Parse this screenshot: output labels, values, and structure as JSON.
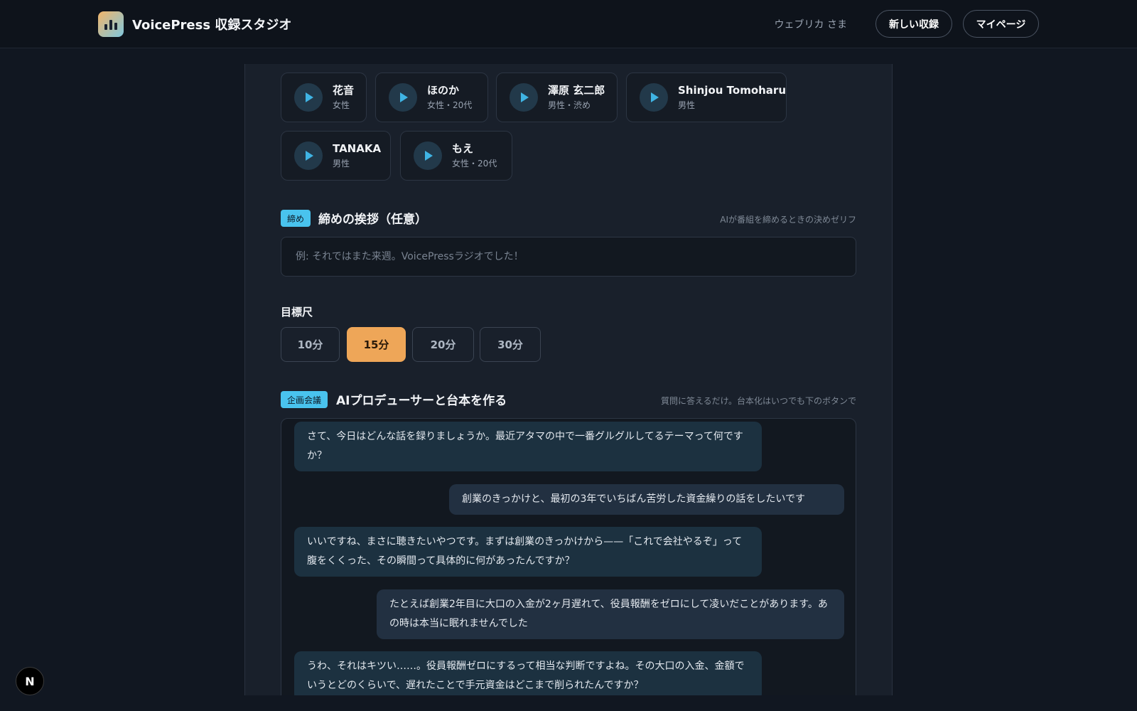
{
  "header": {
    "title": "VoicePress 収録スタジオ",
    "user": "ウェブリカ さま",
    "new_recording": "新しい収録",
    "mypage": "マイページ"
  },
  "voices": [
    {
      "name": "花音",
      "desc": "女性"
    },
    {
      "name": "ほのか",
      "desc": "女性・20代"
    },
    {
      "name": "澤原 玄二郎",
      "desc": "男性・渋め"
    },
    {
      "name": "Shinjou Tomoharu",
      "desc": "男性"
    },
    {
      "name": "TANAKA",
      "desc": "男性"
    },
    {
      "name": "もえ",
      "desc": "女性・20代"
    }
  ],
  "closing": {
    "badge": "締め",
    "title": "締めの挨拶（任意）",
    "hint": "AIが番組を締めるときの決めゼリフ",
    "placeholder": "例: それではまた来週。VoicePressラジオでした！"
  },
  "duration": {
    "label": "目標尺",
    "options": [
      "10分",
      "15分",
      "20分",
      "30分"
    ],
    "selected": "15分"
  },
  "planning": {
    "badge": "企画会議",
    "title": "AIプロデューサーと台本を作る",
    "hint": "質問に答えるだけ。台本化はいつでも下のボタンで"
  },
  "chat": [
    {
      "role": "ai",
      "text": "さて、今日はどんな話を録りましょうか。最近アタマの中で一番グルグルしてるテーマって何ですか？"
    },
    {
      "role": "user",
      "text": "創業のきっかけと、最初の3年でいちばん苦労した資金繰りの話をしたいです"
    },
    {
      "role": "ai",
      "text": "いいですね、まさに聴きたいやつです。まずは創業のきっかけから——「これで会社やるぞ」って腹をくくった、その瞬間って具体的に何があったんですか？"
    },
    {
      "role": "user",
      "text": "たとえば創業2年目に大口の入金が2ヶ月遅れて、役員報酬をゼロにして凌いだことがあります。あの時は本当に眠れませんでした"
    },
    {
      "role": "ai",
      "text": "うわ、それはキツい……。役員報酬ゼロにするって相当な判断ですよね。その大口の入金、金額でいうとどのくらいで、遅れたことで手元資金はどこまで削られたんですか？"
    }
  ],
  "dev_badge": "N",
  "colors": {
    "accent_orange": "#eea658",
    "accent_blue": "#49c3ee",
    "background": "#111721",
    "panel": "#19202b"
  }
}
